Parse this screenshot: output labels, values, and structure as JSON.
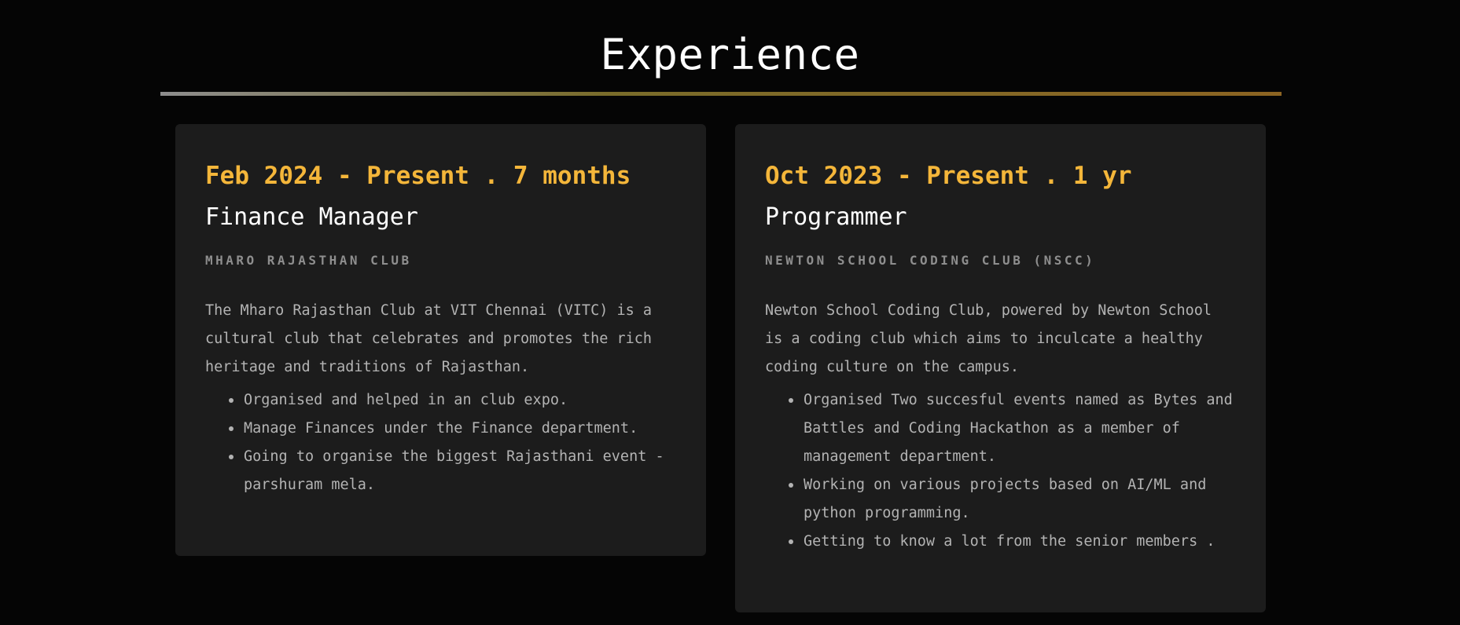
{
  "section": {
    "title": "Experience"
  },
  "experiences": [
    {
      "duration": "Feb 2024 - Present . 7 months",
      "role": "Finance Manager",
      "organization": "MHARO RAJASTHAN CLUB",
      "description": "The Mharo Rajasthan Club at VIT Chennai (VITC) is a cultural club that celebrates and promotes the rich heritage and traditions of Rajasthan.",
      "bullets": [
        "Organised and helped in an club expo.",
        "Manage Finances under the Finance department.",
        "Going to organise the biggest Rajasthani event - parshuram mela."
      ]
    },
    {
      "duration": "Oct 2023 - Present . 1 yr",
      "role": "Programmer",
      "organization": "NEWTON SCHOOL CODING CLUB (NSCC)",
      "description": "Newton School Coding Club, powered by Newton School is a coding club which aims to inculcate a healthy coding culture on the campus.",
      "bullets": [
        "Organised Two succesful events named as Bytes and Battles and Coding Hackathon as a member of management department.",
        "Working on various projects based on AI/ML and python programming.",
        "Getting to know a lot from the senior members ."
      ]
    }
  ],
  "colors": {
    "accent": "#f4b63a",
    "card_background": "#1c1c1c",
    "page_background": "#050505",
    "muted_text": "#b3b3b3"
  }
}
